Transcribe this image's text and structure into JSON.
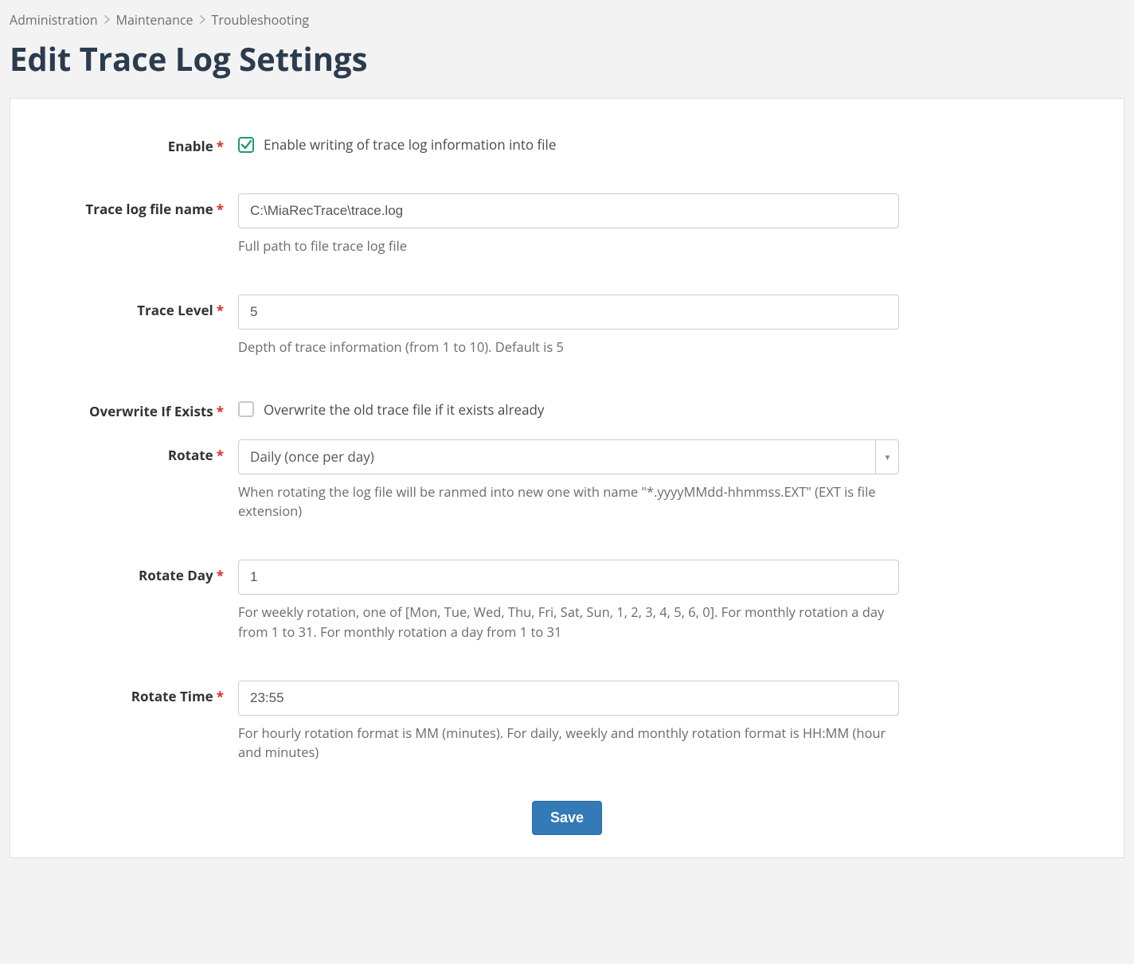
{
  "breadcrumb": {
    "items": [
      "Administration",
      "Maintenance",
      "Troubleshooting"
    ]
  },
  "page": {
    "title": "Edit Trace Log Settings"
  },
  "form": {
    "enable": {
      "label": "Enable",
      "checked": true,
      "text": "Enable writing of trace log information into file"
    },
    "trace_file": {
      "label": "Trace log file name",
      "value": "C:\\MiaRecTrace\\trace.log",
      "help": "Full path to file trace log file"
    },
    "trace_level": {
      "label": "Trace Level",
      "value": "5",
      "help": "Depth of trace information (from 1 to 10). Default is 5"
    },
    "overwrite": {
      "label": "Overwrite If Exists",
      "checked": false,
      "text": "Overwrite the old trace file if it exists already"
    },
    "rotate": {
      "label": "Rotate",
      "value": "Daily (once per day)",
      "help": "When rotating the log file will be ranmed into new one with name \"*.yyyyMMdd-hhmmss.EXT\" (EXT is file extension)"
    },
    "rotate_day": {
      "label": "Rotate Day",
      "value": "1",
      "help": "For weekly rotation, one of [Mon, Tue, Wed, Thu, Fri, Sat, Sun, 1, 2, 3, 4, 5, 6, 0]. For monthly rotation a day from 1 to 31. For monthly rotation a day from 1 to 31"
    },
    "rotate_time": {
      "label": "Rotate Time",
      "value": "23:55",
      "help": "For hourly rotation format is MM (minutes). For daily, weekly and monthly rotation format is HH:MM (hour and minutes)"
    },
    "save_label": "Save"
  }
}
